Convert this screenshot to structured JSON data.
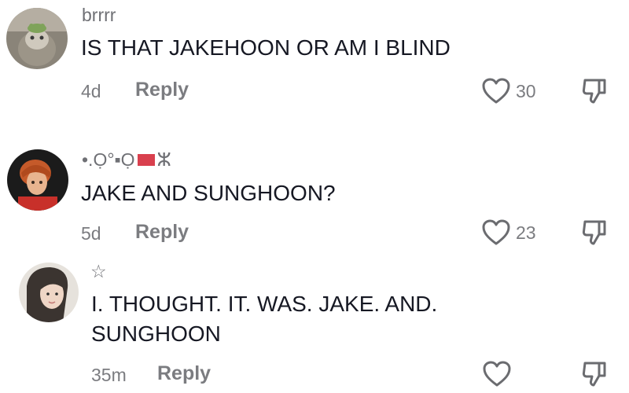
{
  "comments": [
    {
      "username": "brrrr",
      "text": "IS THAT JAKEHOON OR AM I BLIND",
      "time": "4d",
      "reply_label": "Reply",
      "likes": "30"
    },
    {
      "username_prefix": "•.Ọ°▪Ọ",
      "username_suffix": "ⵣ",
      "text": "JAKE AND SUNGHOON?",
      "time": "5d",
      "reply_label": "Reply",
      "likes": "23"
    },
    {
      "username": "☆",
      "text": "I. THOUGHT. IT. WAS. JAKE. AND.\nSUNGHOON",
      "time": "35m",
      "reply_label": "Reply",
      "likes": ""
    }
  ],
  "colors": {
    "text": "#161823",
    "secondary": "#7b7c80",
    "flag": "#d9404e"
  },
  "icons": [
    "avatar-cat",
    "avatar-person",
    "avatar-girl",
    "heart-icon",
    "dislike-icon"
  ]
}
